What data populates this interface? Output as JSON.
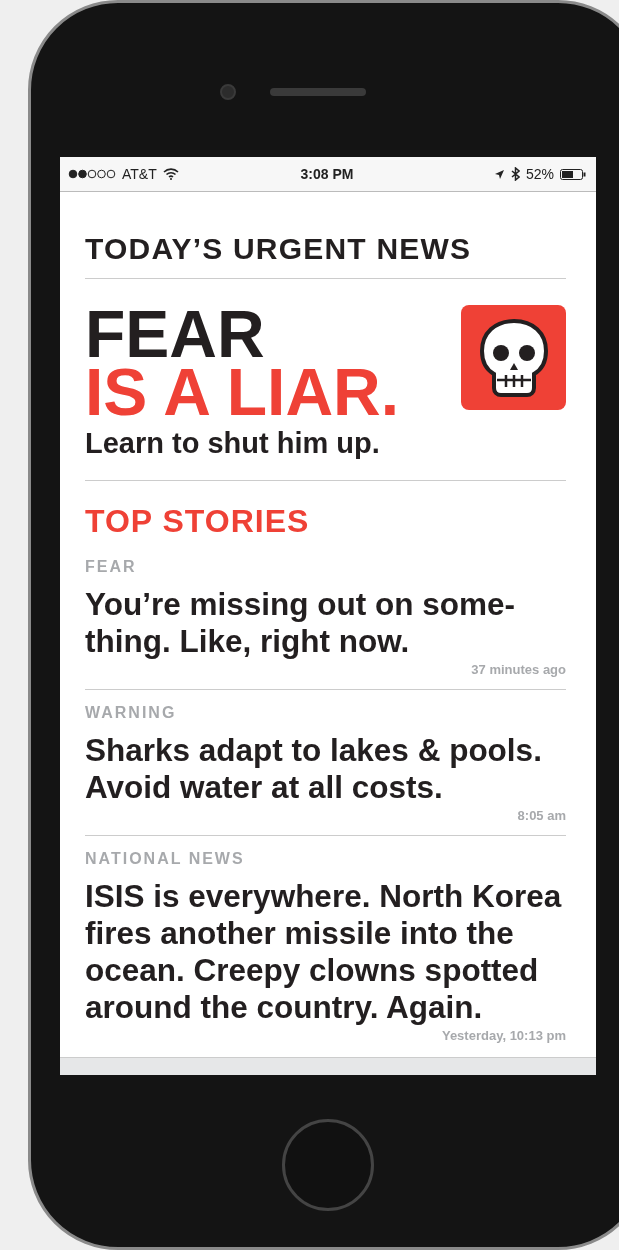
{
  "status_bar": {
    "carrier": "AT&T",
    "time": "3:08 PM",
    "battery": "52%"
  },
  "header": {
    "title": "TODAY’S URGENT NEWS"
  },
  "hero": {
    "line_1": "FEAR",
    "line_2": "IS A LIAR.",
    "subtitle": "Learn to shut him up."
  },
  "section": {
    "title": "TOP STORIES"
  },
  "stories": [
    {
      "category": "FEAR",
      "headline": "You’re missing out on some-thing. Like, right now.",
      "time": "37 minutes ago"
    },
    {
      "category": "WARNING",
      "headline": "Sharks adapt to lakes & pools. Avoid water at all costs.",
      "time": "8:05 am"
    },
    {
      "category": "NATIONAL NEWS",
      "headline": "ISIS is everywhere. North Korea fires another missile into the ocean. Creepy clowns spotted around the country. Again.",
      "time": "Yesterday, 10:13 pm"
    }
  ]
}
